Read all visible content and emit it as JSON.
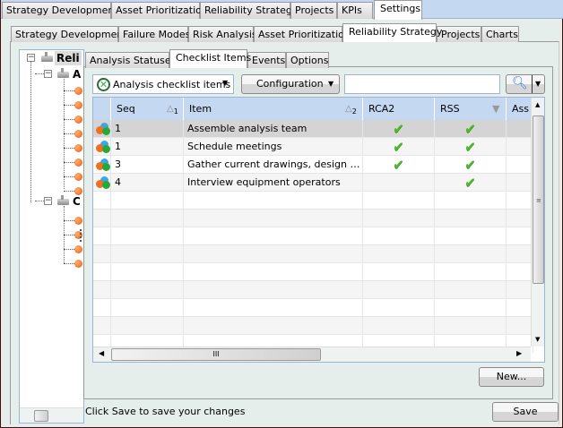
{
  "top_tabs": [
    "Strategy Development",
    "Asset Prioritization",
    "Reliability Strategy",
    "Projects",
    "KPIs",
    "Settings"
  ],
  "top_tab_selected": "Settings",
  "sub_tabs": [
    "Strategy Development",
    "Failure Modes",
    "Risk Analysis",
    "Asset Prioritization",
    "Reliability Strategy",
    "Projects",
    "Charts"
  ],
  "sub_tab_selected": "Reliability Strategy",
  "tree": {
    "root": "Reli",
    "child1": "A",
    "child2": "C"
  },
  "inner_tabs": [
    "Analysis Statuses",
    "Checklist Items",
    "Events",
    "Options"
  ],
  "inner_tab_selected": "Checklist Items",
  "toolbar": {
    "view_select": "Analysis checklist items",
    "config_label": "Configuration",
    "search_value": ""
  },
  "grid": {
    "columns": [
      "Seq",
      "Item",
      "RCA2",
      "RSS",
      "Ass"
    ],
    "sort": {
      "seq": "1",
      "item": "2"
    },
    "rows": [
      {
        "seq": "1",
        "item": "Assemble analysis team",
        "rca2": "✔",
        "rss": "✔"
      },
      {
        "seq": "1",
        "item": "Schedule meetings",
        "rca2": "✔",
        "rss": "✔"
      },
      {
        "seq": "3",
        "item": "Gather current drawings, design specifications",
        "rca2": "✔",
        "rss": "✔"
      },
      {
        "seq": "4",
        "item": "Interview equipment operators",
        "rca2": "",
        "rss": "✔"
      }
    ],
    "hscroll_grip": "III"
  },
  "new_label": "New...",
  "status": "Click Save to save your changes",
  "save_label": "Save",
  "colors": {
    "header": "#c4d9f1",
    "selected_row": "#d4d4d4",
    "check": "#4cbd2c"
  }
}
